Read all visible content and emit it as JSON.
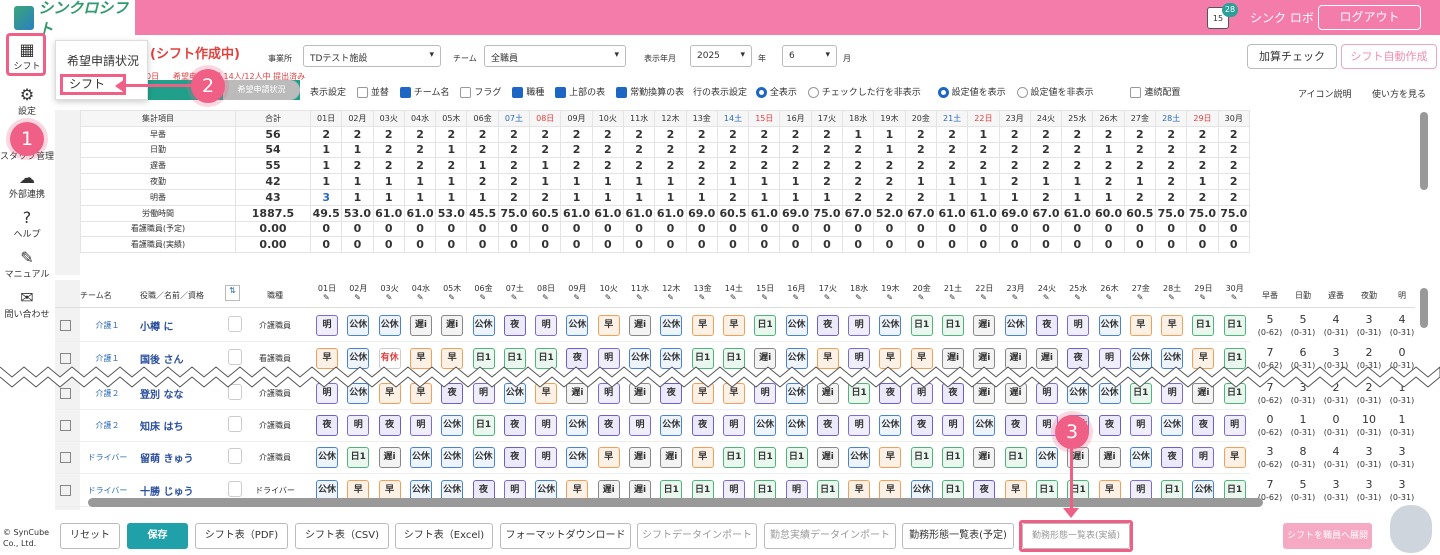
{
  "app": {
    "logo": "シンクロシフト",
    "user": "シンク ロボ",
    "logout": "ログアウト",
    "cal_day": "15",
    "cal_badge": "28"
  },
  "sidebar": [
    {
      "label": "シフト",
      "icon": "calendar-icon"
    },
    {
      "label": "設定",
      "icon": "gear-icon"
    },
    {
      "label": "スタッフ管理",
      "icon": "database-icon"
    },
    {
      "label": "外部連携",
      "icon": "cloud-sync-icon"
    },
    {
      "label": "ヘルプ",
      "icon": "help-icon"
    },
    {
      "label": "マニュアル",
      "icon": "pencil-icon"
    },
    {
      "label": "問い合わせ",
      "icon": "mail-icon"
    }
  ],
  "menu": {
    "item1": "希望申請状況",
    "item2": "シフト"
  },
  "markers": {
    "m1": "1",
    "m2": "2",
    "m3": "3"
  },
  "page_title": "(シフト作成中)",
  "filters": {
    "office_label": "事業所",
    "office": "TDテスト施設",
    "team_label": "チーム",
    "team": "全職員",
    "ym_label": "表示年月",
    "year": "2025",
    "year_unit": "年",
    "month": "6",
    "month_unit": "月"
  },
  "sub": {
    "left": "0日",
    "req": "希望申請状況 14人/12人中 提出済み",
    "req_btn": "希望申請状況"
  },
  "buttons": {
    "calc": "加算チェック",
    "auto": "シフト自動作成"
  },
  "options": {
    "disp": "表示設定",
    "swap": "並替",
    "team": "チーム名",
    "flag": "フラグ",
    "job": "職種",
    "top": "上部の表",
    "conv": "常勤換算の表",
    "row": "行の表示設定",
    "all": "全表示",
    "hide": "チェックした行を非表示",
    "show_set": "設定値を表示",
    "hide_set": "設定値を非表示",
    "cont": "連続配置",
    "icon_help": "アイコン説明",
    "howto": "使い方を見る"
  },
  "days": [
    "01日",
    "02月",
    "03火",
    "04水",
    "05木",
    "06金",
    "07土",
    "08日",
    "09月",
    "10火",
    "11水",
    "12木",
    "13金",
    "14土",
    "15日",
    "16月",
    "17火",
    "18水",
    "19木",
    "20金",
    "21土",
    "22日",
    "23月",
    "24火",
    "25水",
    "26木",
    "27金",
    "28土",
    "29日",
    "30月"
  ],
  "summary": {
    "header_label": "集計項目",
    "header_total": "合計",
    "rows": [
      {
        "label": "早番",
        "total": "56",
        "vals": [
          "2",
          "2",
          "2",
          "2",
          "2",
          "2",
          "2",
          "2",
          "2",
          "2",
          "2",
          "2",
          "2",
          "2",
          "2",
          "2",
          "2",
          "1",
          "1",
          "2",
          "2",
          "1",
          "2",
          "2",
          "2",
          "2",
          "2",
          "2",
          "2",
          "2"
        ]
      },
      {
        "label": "日勤",
        "total": "54",
        "vals": [
          "1",
          "1",
          "2",
          "2",
          "1",
          "2",
          "2",
          "2",
          "2",
          "2",
          "2",
          "2",
          "2",
          "2",
          "2",
          "2",
          "2",
          "2",
          "1",
          "2",
          "2",
          "2",
          "2",
          "2",
          "2",
          "1",
          "2",
          "2",
          "2",
          "2"
        ]
      },
      {
        "label": "遅番",
        "total": "55",
        "vals": [
          "1",
          "2",
          "2",
          "2",
          "2",
          "1",
          "2",
          "1",
          "2",
          "2",
          "2",
          "2",
          "2",
          "2",
          "2",
          "2",
          "2",
          "2",
          "2",
          "2",
          "2",
          "2",
          "2",
          "2",
          "2",
          "2",
          "2",
          "2",
          "2",
          "2"
        ]
      },
      {
        "label": "夜勤",
        "total": "42",
        "vals": [
          "1",
          "1",
          "1",
          "1",
          "1",
          "2",
          "2",
          "1",
          "1",
          "1",
          "1",
          "1",
          "2",
          "1",
          "1",
          "1",
          "2",
          "2",
          "2",
          "1",
          "1",
          "1",
          "2",
          "1",
          "1",
          "2",
          "1",
          "2",
          "1",
          "2"
        ]
      },
      {
        "label": "明番",
        "total": "43",
        "vals": [
          "3",
          "1",
          "1",
          "1",
          "1",
          "1",
          "2",
          "2",
          "1",
          "1",
          "1",
          "1",
          "1",
          "2",
          "1",
          "1",
          "1",
          "2",
          "2",
          "2",
          "1",
          "1",
          "1",
          "2",
          "1",
          "1",
          "2",
          "2",
          "2",
          "2"
        ]
      },
      {
        "label": "労働時間",
        "total": "1887.5",
        "vals": [
          "49.5",
          "53.0",
          "61.0",
          "61.0",
          "53.0",
          "45.5",
          "75.0",
          "60.5",
          "61.0",
          "61.0",
          "61.0",
          "61.0",
          "69.0",
          "60.5",
          "61.0",
          "69.0",
          "75.0",
          "67.0",
          "52.0",
          "67.0",
          "61.0",
          "61.0",
          "69.0",
          "67.0",
          "61.0",
          "60.0",
          "60.5",
          "75.0",
          "75.0",
          "75.0"
        ]
      },
      {
        "label": "看護職員(予定)",
        "total": "0.00",
        "vals": [
          "0",
          "0",
          "0",
          "0",
          "0",
          "0",
          "0",
          "0",
          "0",
          "0",
          "0",
          "0",
          "0",
          "0",
          "0",
          "0",
          "0",
          "0",
          "0",
          "0",
          "0",
          "0",
          "0",
          "0",
          "0",
          "0",
          "0",
          "0",
          "0",
          "0"
        ]
      },
      {
        "label": "看護職員(実績)",
        "total": "0.00",
        "vals": [
          "0",
          "0",
          "0",
          "0",
          "0",
          "0",
          "0",
          "0",
          "0",
          "0",
          "0",
          "0",
          "0",
          "0",
          "0",
          "0",
          "0",
          "0",
          "0",
          "0",
          "0",
          "0",
          "0",
          "0",
          "0",
          "0",
          "0",
          "0",
          "0",
          "0"
        ]
      }
    ]
  },
  "staff_header": {
    "team": "チーム名",
    "name": "役職／名前／資格",
    "job": "職種",
    "sums": [
      "早番",
      "日勤",
      "遅番",
      "夜勤",
      "明"
    ]
  },
  "staff": [
    {
      "team": "介護１",
      "name": "小樽 に",
      "role": "介護職員",
      "cells": [
        "明",
        "公休",
        "公休",
        "遅i",
        "遅i",
        "公休",
        "夜",
        "明",
        "公休",
        "早",
        "遅i",
        "公休",
        "早",
        "早",
        "日1",
        "公休",
        "夜",
        "明",
        "公休",
        "日1",
        "日1",
        "遅i",
        "公休",
        "夜",
        "明",
        "公休",
        "早",
        "早",
        "日1",
        "日1"
      ],
      "sums": [
        [
          "5",
          "(0-62)"
        ],
        [
          "5",
          "(0-31)"
        ],
        [
          "4",
          "(0-31)"
        ],
        [
          "3",
          "(0-31)"
        ],
        [
          "4",
          "(0-31)"
        ]
      ]
    },
    {
      "team": "介護１",
      "name": "国後 さん",
      "role": "看護職員",
      "cells": [
        "早",
        "公休",
        "有休",
        "早",
        "早",
        "日1",
        "日1",
        "日1",
        "夜",
        "明",
        "公休",
        "公休",
        "日1",
        "日1",
        "遅i",
        "公休",
        "早",
        "明",
        "早",
        "早",
        "遅i",
        "遅i",
        "遅i",
        "遅i",
        "夜",
        "明",
        "公休",
        "公休",
        "早",
        "日1"
      ],
      "sums": [
        [
          "7",
          "(0-62)"
        ],
        [
          "6",
          "(0-31)"
        ],
        [
          "3",
          "(0-31)"
        ],
        [
          "2",
          "(0-31)"
        ],
        [
          "0",
          "(0-31)"
        ]
      ]
    },
    {
      "team": "介護２",
      "name": "登別 なな",
      "role": "介護職員",
      "cells": [
        "明",
        "公休",
        "早",
        "早",
        "夜",
        "明",
        "公休",
        "早",
        "遅i",
        "明",
        "遅i",
        "夜",
        "早",
        "早",
        "明",
        "公休",
        "遅i",
        "日1",
        "夜",
        "明",
        "夜",
        "遅i",
        "遅i",
        "明",
        "公休",
        "公休",
        "日1",
        "明",
        "遅i",
        "日1"
      ],
      "sums": [
        [
          "7",
          "(0-62)"
        ],
        [
          "3",
          "(0-31)"
        ],
        [
          "2",
          "(0-31)"
        ],
        [
          "2",
          "(0-31)"
        ],
        [
          "1",
          "(0-31)"
        ]
      ]
    },
    {
      "team": "介護２",
      "name": "知床 はち",
      "role": "介護職員",
      "cells": [
        "夜",
        "明",
        "夜",
        "明",
        "公休",
        "日1",
        "夜",
        "明",
        "公休",
        "夜",
        "明",
        "公休",
        "夜",
        "明",
        "公休",
        "公休",
        "夜",
        "明",
        "公休",
        "夜",
        "明",
        "公休",
        "夜",
        "明",
        "公休",
        "夜",
        "明",
        "公休",
        "夜",
        "明"
      ],
      "sums": [
        [
          "0",
          "(0-62)"
        ],
        [
          "1",
          "(0-31)"
        ],
        [
          "0",
          "(0-31)"
        ],
        [
          "10",
          "(0-31)"
        ],
        [
          "1",
          "(0-31)"
        ]
      ]
    },
    {
      "team": "ドライバー",
      "name": "留萌 きゅう",
      "role": "介護職員",
      "cells": [
        "公休",
        "日1",
        "遅i",
        "公休",
        "公休",
        "公休",
        "夜",
        "明",
        "公休",
        "早",
        "遅i",
        "遅i",
        "早",
        "日1",
        "日1",
        "日1",
        "遅i",
        "公休",
        "早",
        "日1",
        "日1",
        "遅i",
        "日1",
        "公休",
        "遅i",
        "遅i",
        "公休",
        "夜",
        "明",
        "早"
      ],
      "sums": [
        [
          "3",
          "(0-62)"
        ],
        [
          "8",
          "(0-31)"
        ],
        [
          "4",
          "(0-31)"
        ],
        [
          "3",
          "(0-31)"
        ],
        [
          "3",
          "(0-31)"
        ]
      ]
    },
    {
      "team": "ドライバー",
      "name": "十勝 じゅう",
      "role": "ドライバー",
      "cells": [
        "公休",
        "早",
        "早",
        "公休",
        "公休",
        "夜",
        "明",
        "公休",
        "早",
        "遅i",
        "遅i",
        "日1",
        "日1",
        "明",
        "日1",
        "明",
        "日1",
        "早",
        "早",
        "公休",
        "日1",
        "夜",
        "早",
        "日1",
        "日1",
        "早",
        "明",
        "日1",
        "公休",
        "日1"
      ],
      "sums": [
        [
          "7",
          "(0-62)"
        ],
        [
          "5",
          "(0-31)"
        ],
        [
          "3",
          "(0-31)"
        ],
        [
          "3",
          "(0-31)"
        ],
        [
          "3",
          "(0-31)"
        ]
      ]
    }
  ],
  "bottom": {
    "copy1": "© SynCube",
    "copy2": "Co., Ltd.",
    "reset": "リセット",
    "save": "保存",
    "pdf": "シフト表（PDF)",
    "csv": "シフト表（CSV)",
    "excel": "シフト表（Excel)",
    "fmt": "フォーマットダウンロード",
    "import": "シフトデータインポート",
    "att": "勤怠実績データインポート",
    "plan": "勤務形態一覧表(予定)",
    "actual": "勤務形態一覧表(実績)",
    "expand": "シフトを職員へ展開"
  },
  "colors": {
    "accent": "#f47cab",
    "teal": "#20a08a",
    "marker": "#ef5f86"
  }
}
